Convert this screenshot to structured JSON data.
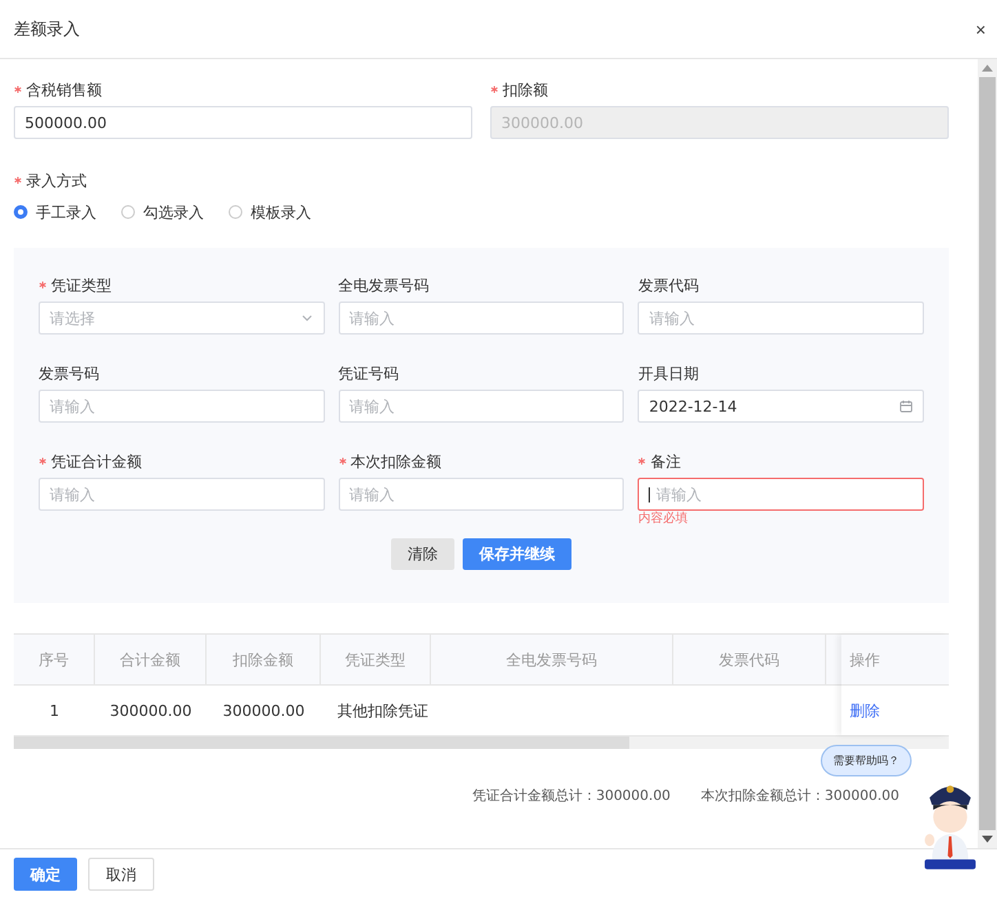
{
  "window": {
    "title": "差额录入",
    "close": "×"
  },
  "top_fields": [
    {
      "label": "含税销售额",
      "required": true,
      "value": "500000.00",
      "disabled": false
    },
    {
      "label": "扣除额",
      "required": true,
      "value": "300000.00",
      "disabled": true
    }
  ],
  "entry_method": {
    "label": "录入方式",
    "required": true,
    "options": [
      {
        "label": "手工录入",
        "selected": true
      },
      {
        "label": "勾选录入",
        "selected": false
      },
      {
        "label": "模板录入",
        "selected": false
      }
    ]
  },
  "voucher_form": {
    "fields": [
      {
        "label": "凭证类型",
        "required": true,
        "kind": "select",
        "placeholder": "请选择"
      },
      {
        "label": "全电发票号码",
        "required": false,
        "kind": "input",
        "placeholder": "请输入"
      },
      {
        "label": "发票代码",
        "required": false,
        "kind": "input",
        "placeholder": "请输入"
      },
      {
        "label": "发票号码",
        "required": false,
        "kind": "input",
        "placeholder": "请输入"
      },
      {
        "label": "凭证号码",
        "required": false,
        "kind": "input",
        "placeholder": "请输入"
      },
      {
        "label": "开具日期",
        "required": false,
        "kind": "date",
        "value": "2022-12-14"
      },
      {
        "label": "凭证合计金额",
        "required": true,
        "kind": "input",
        "placeholder": "请输入"
      },
      {
        "label": "本次扣除金额",
        "required": true,
        "kind": "input",
        "placeholder": "请输入"
      },
      {
        "label": "备注",
        "required": true,
        "kind": "input",
        "placeholder": "请输入",
        "focused": true,
        "error": "内容必填"
      }
    ],
    "buttons": [
      {
        "label": "清除",
        "primary": false
      },
      {
        "label": "保存并继续",
        "primary": true
      }
    ]
  },
  "table": {
    "columns": [
      "序号",
      "合计金额",
      "扣除金额",
      "凭证类型",
      "全电发票号码",
      "发票代码",
      "操作"
    ],
    "rows": [
      {
        "cells": [
          "1",
          "300000.00",
          "300000.00",
          "其他扣除凭证",
          "",
          ""
        ],
        "action": "删除"
      }
    ]
  },
  "totals": [
    "凭证合计金额总计：300000.00",
    "本次扣除金额总计：300000.00"
  ],
  "help_bubble": "需要帮助吗？",
  "footer_buttons": [
    {
      "label": "确定",
      "primary": true
    },
    {
      "label": "取消",
      "primary": false
    }
  ]
}
